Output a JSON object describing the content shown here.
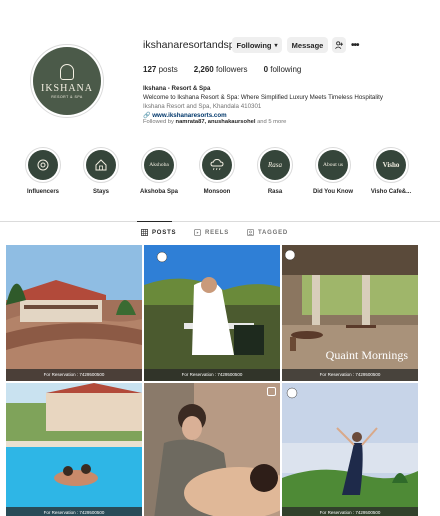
{
  "profile": {
    "username": "ikshanaresortandspa",
    "following_label": "Following",
    "message_label": "Message",
    "posts_count": "127",
    "posts_label": "posts",
    "followers_count": "2,260",
    "followers_label": "followers",
    "following_count": "0",
    "following_count_label": "following",
    "name": "Ikshana - Resort & Spa",
    "bio": "Welcome to Ikshana Resort & Spa: Where Simplified Luxury Meets Timeless Hospitality",
    "location": "Ikshana Resort and Spa, Khandala 410301",
    "website": "www.ikshanaresorts.com",
    "followed_prefix": "Followed by ",
    "followed_users": "namrata87, anushakaursohel",
    "followed_suffix": " and 5 more",
    "avatar_brand": "IKSHANA",
    "avatar_sub": "RESORT & SPA"
  },
  "highlights": [
    {
      "label": "Influencers",
      "icon": "seal-icon",
      "text": ""
    },
    {
      "label": "Stays",
      "icon": "house-icon",
      "text": ""
    },
    {
      "label": "Akshoba Spa",
      "icon": "text",
      "text": "Akshoba"
    },
    {
      "label": "Monsoon",
      "icon": "cloud-rain-icon",
      "text": ""
    },
    {
      "label": "Rasa",
      "icon": "text",
      "text": "Rasa"
    },
    {
      "label": "Did You Know",
      "icon": "text",
      "text": "About us"
    },
    {
      "label": "Visho Cafe&...",
      "icon": "text",
      "text": "Visho"
    }
  ],
  "tabs": {
    "posts": "POSTS",
    "reels": "REELS",
    "tagged": "TAGGED"
  },
  "posts": [
    {
      "caption": "For Reservation : 7429500500"
    },
    {
      "caption": "For Reservation : 7429500500"
    },
    {
      "caption": "For Reservation : 7429500500",
      "overlay": "Quaint Mornings"
    },
    {
      "caption": "For Reservation : 7429500500"
    },
    {
      "caption": ""
    },
    {
      "caption": "For Reservation : 7429500500"
    }
  ],
  "colors": {
    "brand_green": "#4b5a49",
    "highlight_green": "#35453a",
    "link_blue": "#00376b"
  }
}
